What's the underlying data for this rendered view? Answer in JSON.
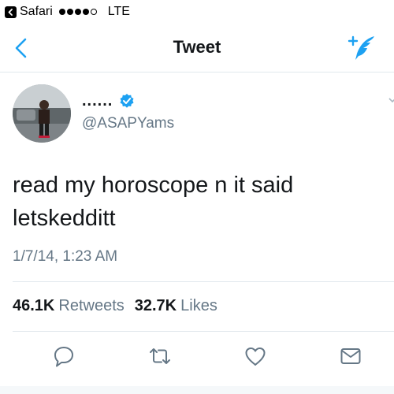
{
  "status_bar": {
    "back_app": "Safari",
    "carrier": "LTE",
    "signal_bars_filled": 4,
    "signal_bars_total": 5
  },
  "nav": {
    "title": "Tweet",
    "back_icon": "chevron-left-icon",
    "compose_icon": "compose-tweet-icon"
  },
  "tweet": {
    "display_name": "......",
    "handle": "@ASAPYams",
    "verified": true,
    "text_line1": "read my horoscope n it said",
    "text_line2": "letskedditt",
    "timestamp": "1/7/14, 1:23 AM",
    "retweets_count": "46.1K",
    "retweets_label": "Retweets",
    "likes_count": "32.7K",
    "likes_label": "Likes"
  },
  "actions": [
    "reply-icon",
    "retweet-icon",
    "like-icon",
    "message-icon"
  ],
  "colors": {
    "accent": "#1da1f2",
    "text": "#14171a",
    "secondary": "#657786",
    "divider": "#e1e8ed"
  }
}
